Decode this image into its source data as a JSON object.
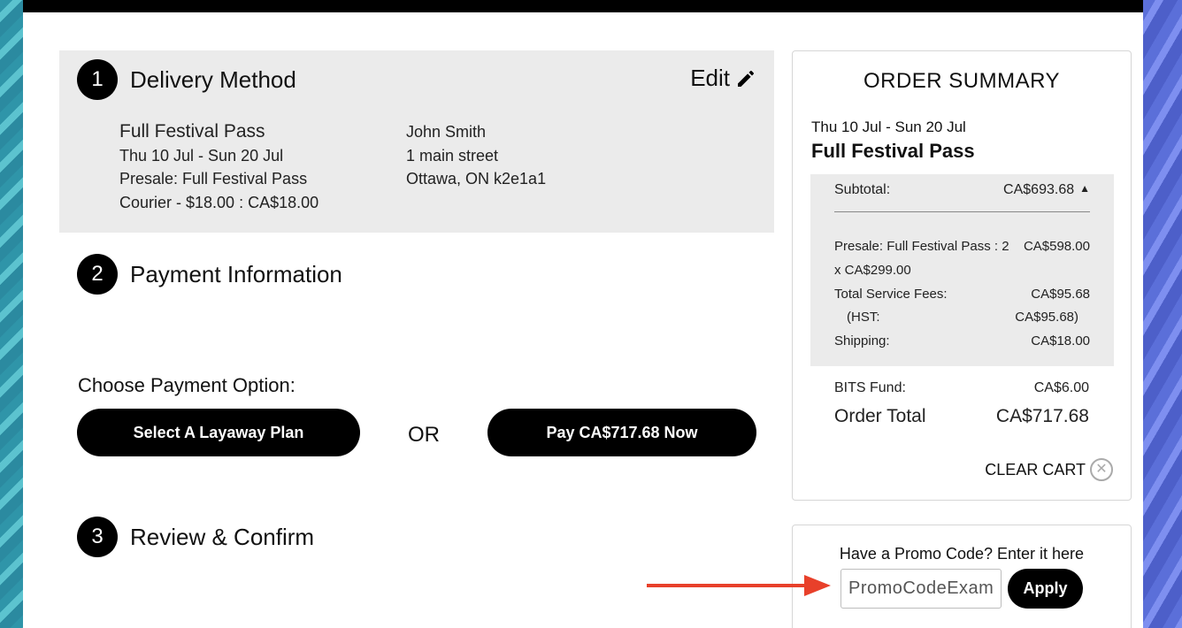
{
  "steps": {
    "delivery": {
      "number": "1",
      "title": "Delivery Method",
      "edit_label": "Edit",
      "ticket": {
        "name": "Full Festival Pass",
        "dates": "Thu 10 Jul - Sun 20 Jul",
        "presale": "Presale: Full Festival Pass",
        "courier": "Courier - $18.00 : CA$18.00"
      },
      "address": {
        "name": "John Smith",
        "street": "1 main street",
        "city": "Ottawa, ON k2e1a1"
      }
    },
    "payment": {
      "number": "2",
      "title": "Payment Information",
      "choose_label": "Choose Payment Option:",
      "layaway_button": "Select A Layaway Plan",
      "or_text": "OR",
      "pay_now_button": "Pay CA$717.68 Now"
    },
    "review": {
      "number": "3",
      "title": "Review & Confirm"
    }
  },
  "summary": {
    "title": "ORDER SUMMARY",
    "dates": "Thu 10 Jul - Sun 20 Jul",
    "product": "Full Festival Pass",
    "subtotal_label": "Subtotal:",
    "subtotal_value": "CA$693.68",
    "lines": {
      "presale_label": "Presale: Full Festival Pass : 2",
      "presale_value": "CA$598.00",
      "presale_unit": "x CA$299.00",
      "fees_label": "Total Service Fees:",
      "fees_value": "CA$95.68",
      "hst_label": "(HST:",
      "hst_value": "CA$95.68)",
      "shipping_label": "Shipping:",
      "shipping_value": "CA$18.00"
    },
    "bits_label": "BITS Fund:",
    "bits_value": "CA$6.00",
    "total_label": "Order Total",
    "total_value": "CA$717.68",
    "clear_cart": "CLEAR CART"
  },
  "promo": {
    "label": "Have a Promo Code? Enter it here",
    "placeholder": "PromoCodeExample",
    "apply": "Apply"
  },
  "colors": {
    "accent": "#000000",
    "panel_gray": "#ebebeb",
    "arrow": "#e8402a"
  },
  "icons": {
    "edit": "pencil-icon",
    "collapse": "chevron-up-icon",
    "clear": "close-circle-icon",
    "pointer": "red-arrow-icon"
  }
}
